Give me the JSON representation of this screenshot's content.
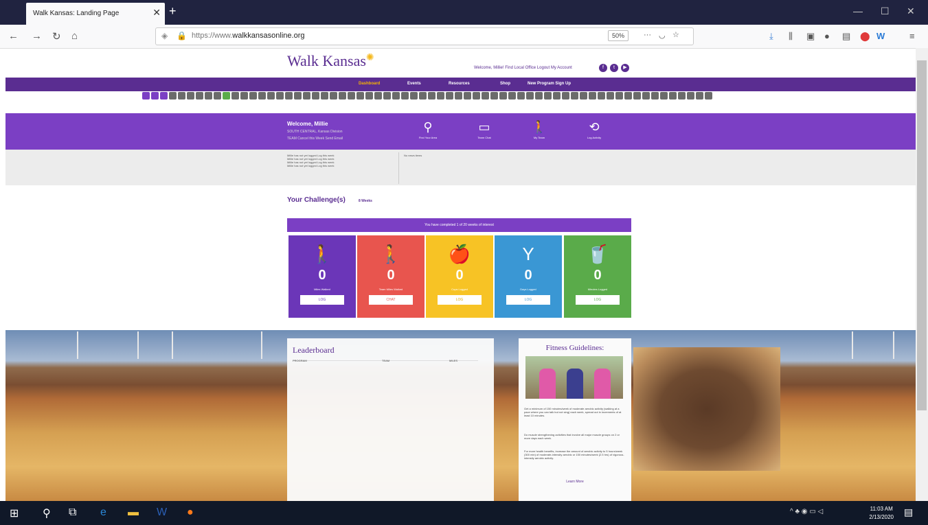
{
  "browser": {
    "tab_title": "Walk Kansas: Landing Page",
    "url_prefix": "https://www.",
    "url_domain": "walkkansasonline.org",
    "zoom": "50%"
  },
  "page": {
    "logo_text": "Walk Kansas",
    "top_links": "Welcome, Millie!   Find Local Office   Logout   My Account",
    "nav": [
      "Dashboard",
      "Events",
      "Resources",
      "Shop",
      "New Program Sign Up"
    ],
    "welcome": {
      "heading": "Welcome, Millie",
      "sub": "SOUTH CENTRAL, Kansas Division",
      "links": "TEAM        Cancel this Week     Send Email"
    },
    "welcome_icons": [
      {
        "name": "Find Your Area",
        "glyph": "⚲"
      },
      {
        "name": "Team Chat",
        "glyph": "▭"
      },
      {
        "name": "My Team",
        "glyph": "🚶"
      },
      {
        "name": "Log Activity",
        "glyph": "⟲"
      }
    ],
    "activity_feed": [
      "Millie has not yet logged   Log this week",
      "Millie has not yet logged   Log this week",
      "Millie has not yet logged   Log this week",
      "Millie has not yet logged   Log this week"
    ],
    "news": "No news items",
    "challenges": {
      "heading": "Your Challenge(s)",
      "tab": "8 Weeks",
      "banner": "You have completed 1 of 20 weeks of interest"
    },
    "cards": [
      {
        "label": "Miles Walked",
        "value": "0",
        "btn": "LOG",
        "color": "#6b36b8",
        "glyph": "🚶"
      },
      {
        "label": "Team Miles Walked",
        "value": "0",
        "btn": "CHAT",
        "color": "#e8554e",
        "glyph": "🚶"
      },
      {
        "label": "Cups Logged",
        "value": "0",
        "btn": "LOG",
        "color": "#f7c325",
        "glyph": "🍎"
      },
      {
        "label": "Days Logged",
        "value": "0",
        "btn": "LOG",
        "color": "#3a97d4",
        "glyph": "Y"
      },
      {
        "label": "Minutes Logged",
        "value": "0",
        "btn": "LOG",
        "color": "#5aab4a",
        "glyph": "🥤"
      }
    ],
    "leaderboard": {
      "heading": "Leaderboard",
      "columns": [
        "PROGRAM",
        "TEAM",
        "MILES"
      ]
    },
    "fitness": {
      "heading": "Fitness Guidelines:",
      "items": [
        "Get a minimum of 150 minutes/week of moderate aerobic activity (walking at a pace where you can talk but not sing) each week, spread out in increments of at least 10 minutes.",
        "Do muscle strengthening activities that involve all major muscle groups on 2 or more days each week.",
        "For more health benefits, increase the amount of aerobic activity to 5 hours/week (300 min) of moderate-intensity aerobic or 150 minutes/week (2.5 hrs) of vigorous-intensity aerobic activity."
      ],
      "more": "Learn More"
    }
  },
  "taskbar": {
    "time": "11:03 AM",
    "date": "2/13/2020"
  }
}
